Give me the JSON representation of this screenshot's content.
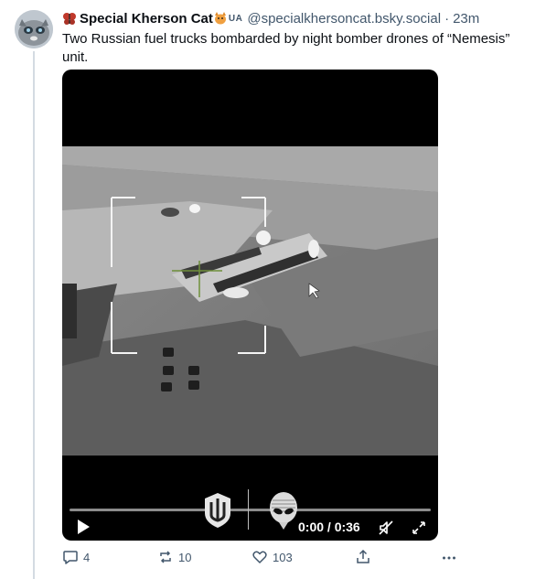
{
  "post": {
    "author_name": "Special Kherson Cat",
    "country_badge": "UA",
    "handle": "@specialkhersoncat.bsky.social",
    "separator": "·",
    "time": "23m",
    "text": "Two Russian fuel trucks bombarded by night bomber drones of “Nemesis” unit."
  },
  "video": {
    "time_display": "0:00 / 0:36",
    "progress": 0,
    "icons": [
      "play-icon",
      "mute-icon",
      "fullscreen-icon",
      "trident-logo",
      "alien-logo"
    ]
  },
  "actions": {
    "replies": "4",
    "reposts": "10",
    "likes": "103",
    "icons": [
      "reply-icon",
      "repost-icon",
      "like-icon",
      "share-icon",
      "more-icon"
    ]
  },
  "colors": {
    "text": "#0b0f14",
    "muted": "#42576c",
    "thread_line": "#d4dbe2"
  }
}
